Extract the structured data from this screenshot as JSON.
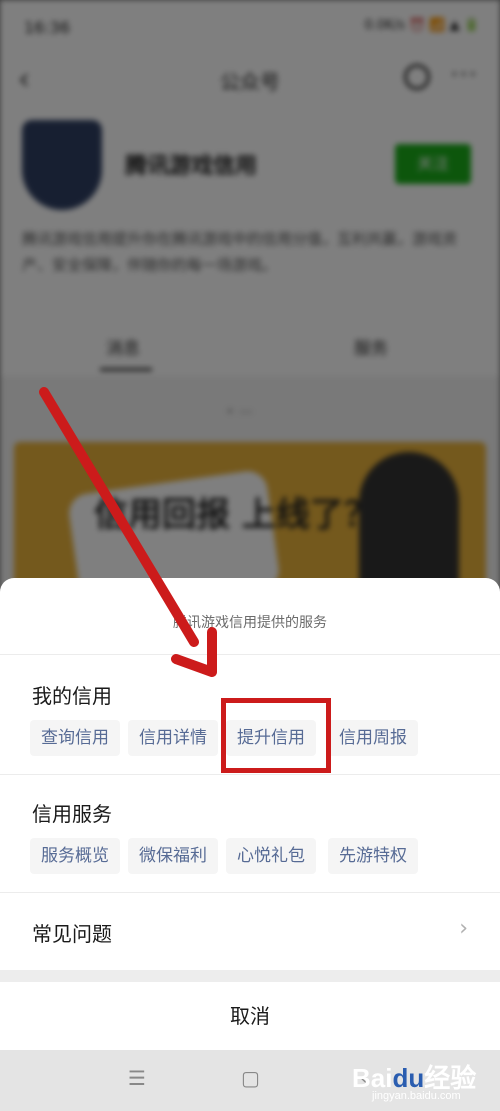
{
  "status_bar": {
    "time": "16:36",
    "indicators": "0.0K/s ⏰ 📶 ▲ 🔋"
  },
  "nav": {
    "title": "公众号"
  },
  "profile": {
    "account_name": "腾讯游戏信用",
    "follow_label": "关注",
    "description": "腾讯游戏信用提升你在腾讯游戏中的信用分值，互利共赢，游戏资产、安全保障，伴随你的每一场游戏。",
    "tabs": [
      "消息",
      "服务"
    ]
  },
  "banner": {
    "text": "信用回报 上线了？"
  },
  "sheet": {
    "header": "腾讯游戏信用提供的服务",
    "sections": [
      {
        "title": "我的信用",
        "chips": [
          "查询信用",
          "信用详情",
          "提升信用",
          "信用周报"
        ]
      },
      {
        "title": "信用服务",
        "chips": [
          "服务概览",
          "微保福利",
          "心悦礼包",
          "先游特权"
        ]
      }
    ],
    "faq": "常见问题",
    "cancel": "取消"
  },
  "annotation": {
    "color": "#cc1b1b",
    "highlighted_item": "提升信用"
  },
  "watermark": {
    "logo_left": "Bai",
    "logo_mid": "du",
    "logo_right": "经验",
    "url": "jingyan.baidu.com"
  },
  "colors": {
    "chip_text": "#576b95",
    "follow_green": "#1aad19",
    "annotation_red": "#cc1b1b"
  }
}
